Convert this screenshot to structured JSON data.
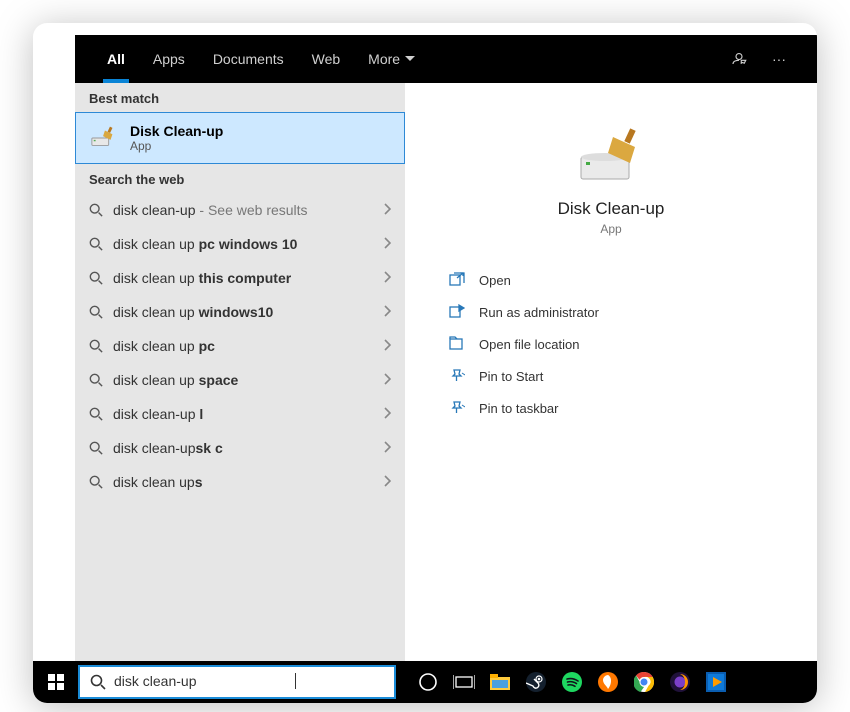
{
  "tabs": {
    "all": "All",
    "apps": "Apps",
    "documents": "Documents",
    "web": "Web",
    "more": "More"
  },
  "sections": {
    "best": "Best match",
    "web": "Search the web"
  },
  "best": {
    "title": "Disk Clean-up",
    "subtitle": "App"
  },
  "suggestions": [
    {
      "pre": "disk clean-up",
      "bold": "",
      "hint": " - See web results"
    },
    {
      "pre": "disk clean up ",
      "bold": "pc windows 10"
    },
    {
      "pre": "disk clean up ",
      "bold": "this computer"
    },
    {
      "pre": "disk clean up ",
      "bold": "windows10"
    },
    {
      "pre": "disk clean up ",
      "bold": "pc"
    },
    {
      "pre": "disk clean up ",
      "bold": "space"
    },
    {
      "pre": "disk clean-up ",
      "bold": "l"
    },
    {
      "pre": "disk clean-up",
      "bold": "sk c"
    },
    {
      "pre": "disk clean up",
      "bold": "s"
    }
  ],
  "detail": {
    "title": "Disk Clean-up",
    "subtitle": "App"
  },
  "actions": [
    {
      "icon": "open",
      "label": "Open"
    },
    {
      "icon": "admin",
      "label": "Run as administrator"
    },
    {
      "icon": "folder",
      "label": "Open file location"
    },
    {
      "icon": "pinstart",
      "label": "Pin to Start"
    },
    {
      "icon": "pintask",
      "label": "Pin to taskbar"
    }
  ],
  "search": {
    "value": "disk clean-up"
  }
}
